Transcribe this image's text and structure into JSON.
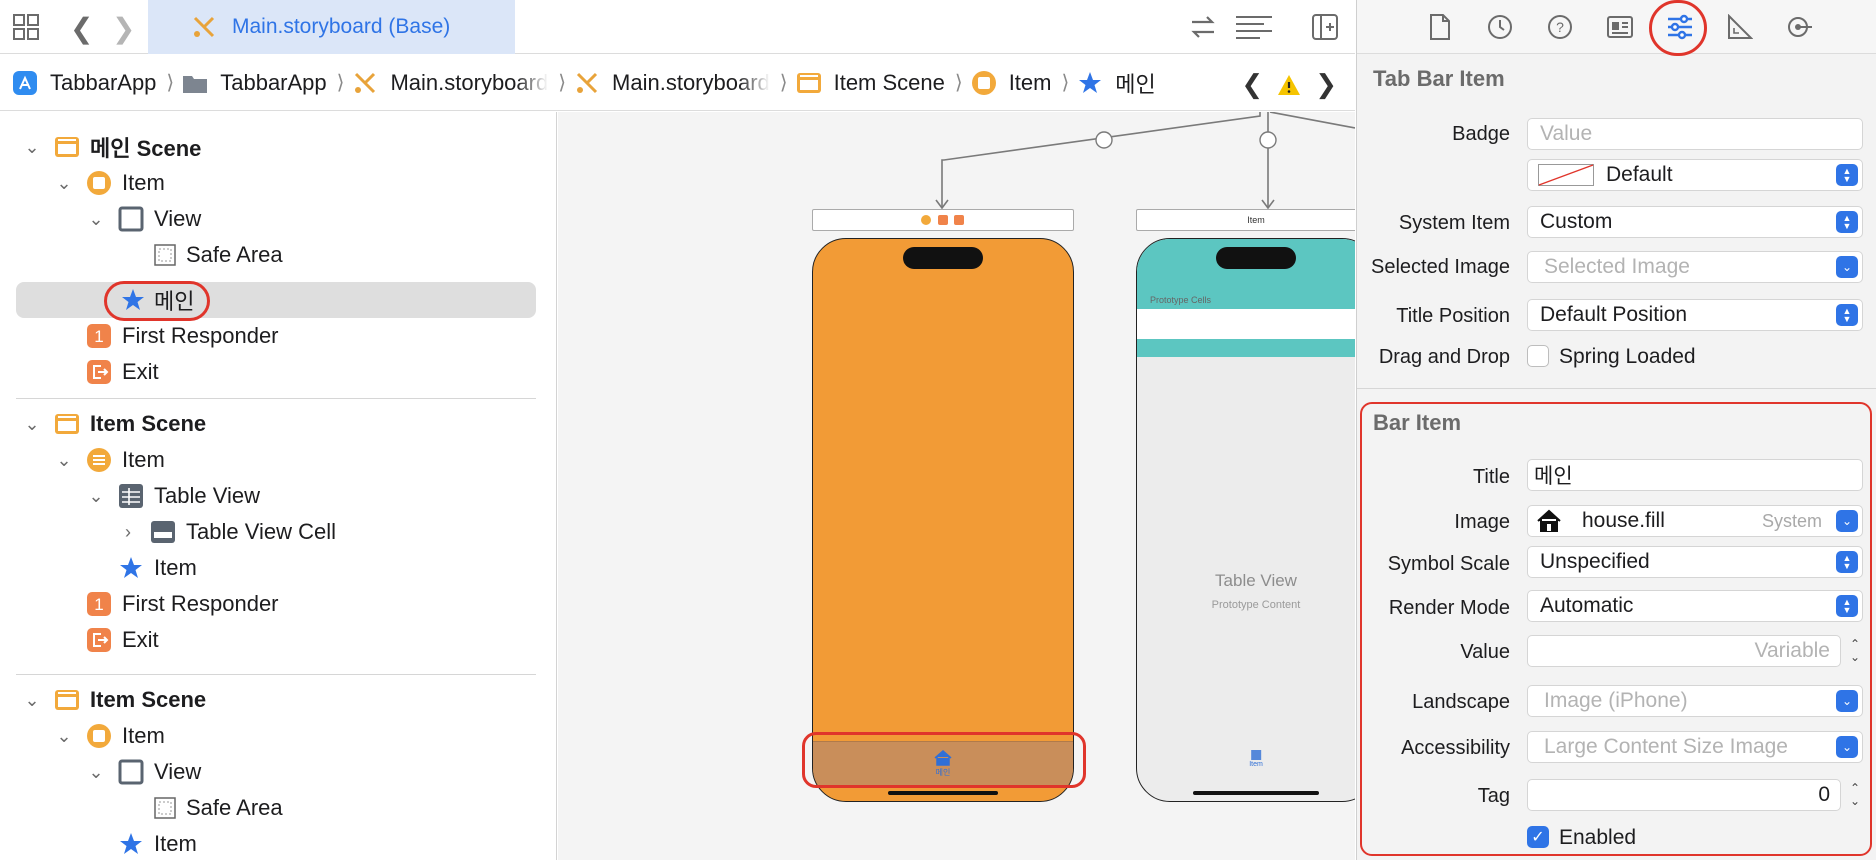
{
  "topbar": {
    "active_tab_label": "Main.storyboard (Base)"
  },
  "breadcrumb": [
    {
      "label": "TabbarApp",
      "icon": "app-store-icon"
    },
    {
      "label": "TabbarApp",
      "icon": "folder-icon"
    },
    {
      "label": "Main.storyboard",
      "icon": "storyboard-icon"
    },
    {
      "label": "Main.storyboard",
      "icon": "storyboard-icon"
    },
    {
      "label": "Item Scene",
      "icon": "scene-icon"
    },
    {
      "label": "Item",
      "icon": "view-controller-icon"
    },
    {
      "label": "메인",
      "icon": "star-icon"
    }
  ],
  "outline": {
    "scene1": {
      "title": "메인 Scene",
      "item": "Item",
      "view": "View",
      "safe_area": "Safe Area",
      "tab_item": "메인",
      "first_responder": "First Responder",
      "exit": "Exit"
    },
    "scene2": {
      "title": "Item Scene",
      "item": "Item",
      "table_view": "Table View",
      "table_view_cell": "Table View Cell",
      "tab_item": "Item",
      "first_responder": "First Responder",
      "exit": "Exit"
    },
    "scene3": {
      "title": "Item Scene",
      "item": "Item",
      "view": "View",
      "safe_area": "Safe Area",
      "tab_item": "Item"
    },
    "badge_number": "1"
  },
  "canvas": {
    "vc2_header": "Item",
    "vc1_tab_label": "메인",
    "vc2_prototype_cells": "Prototype Cells",
    "vc2_table_title": "Table View",
    "vc2_table_sub": "Prototype Content",
    "vc2_tab_label": "Item",
    "colors": {
      "orange": "#f29b36",
      "teal": "#5cc6c1",
      "accent": "#2f74e6",
      "highlight": "#e0352b"
    }
  },
  "inspector": {
    "tab_bar_item": {
      "title": "Tab Bar Item",
      "badge_label": "Badge",
      "badge_placeholder": "Value",
      "badge_color_value": "Default",
      "system_item_label": "System Item",
      "system_item_value": "Custom",
      "selected_image_label": "Selected Image",
      "selected_image_placeholder": "Selected Image",
      "title_position_label": "Title Position",
      "title_position_value": "Default Position",
      "drag_drop_label": "Drag and Drop",
      "spring_loaded_label": "Spring Loaded"
    },
    "bar_item": {
      "title": "Bar Item",
      "title_label": "Title",
      "title_value": "메인",
      "image_label": "Image",
      "image_value": "house.fill",
      "image_hint": "System",
      "symbol_scale_label": "Symbol Scale",
      "symbol_scale_value": "Unspecified",
      "render_mode_label": "Render Mode",
      "render_mode_value": "Automatic",
      "value_label": "Value",
      "value_placeholder": "Variable",
      "landscape_label": "Landscape",
      "landscape_placeholder": "Image (iPhone)",
      "accessibility_label": "Accessibility",
      "accessibility_placeholder": "Large Content Size Image",
      "tag_label": "Tag",
      "tag_value": "0",
      "enabled_label": "Enabled"
    }
  }
}
